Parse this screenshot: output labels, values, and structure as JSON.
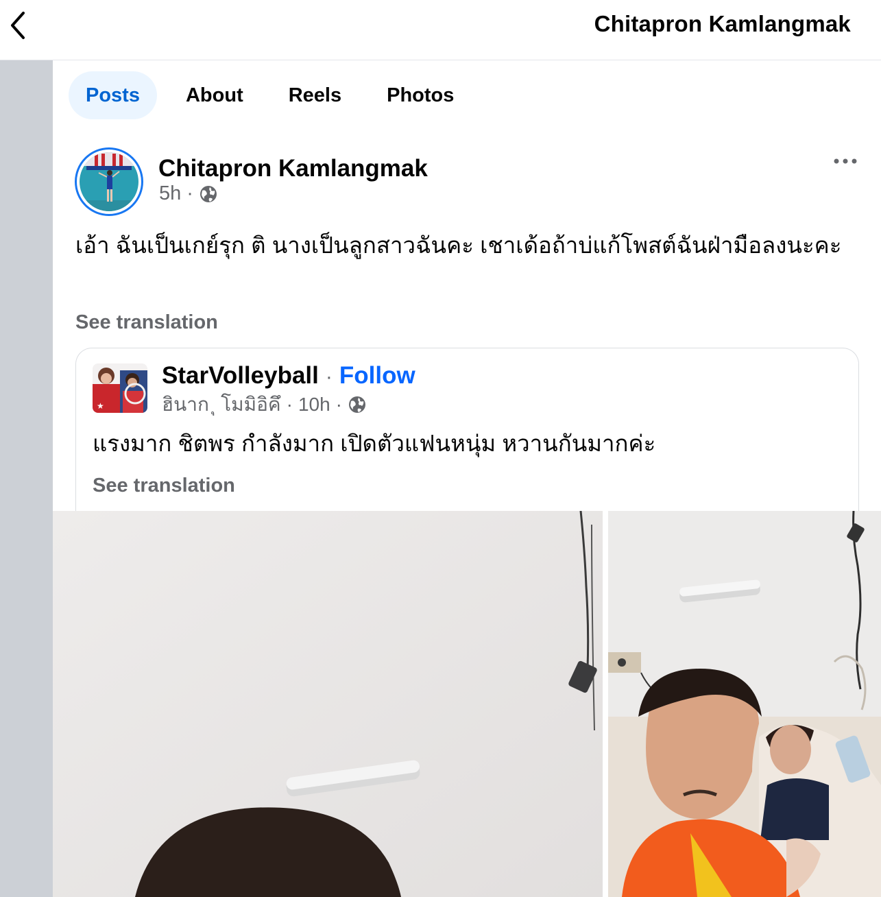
{
  "header": {
    "title": "Chitapron Kamlangmak",
    "back_icon": "chevron-left-icon"
  },
  "tabs": [
    {
      "label": "Posts",
      "active": true
    },
    {
      "label": "About",
      "active": false
    },
    {
      "label": "Reels",
      "active": false
    },
    {
      "label": "Photos",
      "active": false
    }
  ],
  "post": {
    "author": "Chitapron Kamlangmak",
    "time": "5h",
    "separator": "·",
    "audience_icon": "globe-icon",
    "text": "เอ้า ฉันเป็นเกย์รุก ติ นางเป็นลูกสาวฉันคะ   เชาเด้อถ้าบ่แก้โพสต์ฉันฝ่ามือลงนะคะ",
    "see_translation": "See translation",
    "more_icon": "more-options-icon"
  },
  "shared": {
    "page_name": "StarVolleyball",
    "separator": "·",
    "follow": "Follow",
    "author": "ฮินาก ุ โมมิอิคึ",
    "time": "10h",
    "text": "แรงมาก ชิตพร กำลังมาก เปิดตัวแฟนหนุ่ม หวานกันมากค่ะ",
    "see_translation": "See translation"
  },
  "colors": {
    "accent": "#0866ff",
    "active_tab_bg": "#ebf5ff",
    "muted_text": "#65676b"
  }
}
